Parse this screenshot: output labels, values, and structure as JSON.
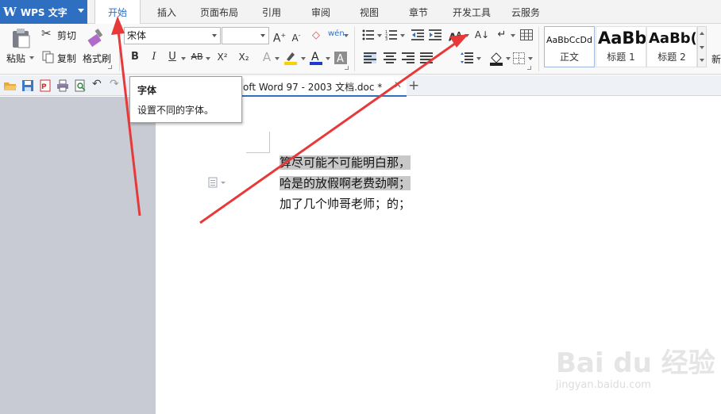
{
  "app": {
    "logo": "W",
    "title": "WPS 文字"
  },
  "tabs": [
    "开始",
    "插入",
    "页面布局",
    "引用",
    "审阅",
    "视图",
    "章节",
    "开发工具",
    "云服务"
  ],
  "clipboard": {
    "paste": "粘贴",
    "cut": "剪切",
    "copy": "复制",
    "format_painter": "格式刷"
  },
  "font": {
    "name": "宋体",
    "size": ""
  },
  "format_buttons": {
    "bold": "B",
    "italic": "I",
    "underline": "U",
    "strike": "AB",
    "superscript": "X²",
    "subscript": "X₂"
  },
  "styles": [
    {
      "sample": "AaBbCcDd",
      "name": "正文"
    },
    {
      "sample": "AaBb",
      "name": "标题 1"
    },
    {
      "sample": "AaBb(",
      "name": "标题 2"
    }
  ],
  "new_style_label": "新",
  "document_tab": {
    "title": "oft Word 97 - 2003 文档.doc *"
  },
  "tooltip": {
    "title": "字体",
    "description": "设置不同的字体。"
  },
  "document": {
    "lines": [
      "算尽可能不可能明白那，",
      "哈是的放假啊老费劲啊；",
      "加了几个帅哥老师；的；"
    ]
  },
  "watermark": {
    "brand": "Bai du 经验",
    "url": "jingyan.baidu.com"
  },
  "colors": {
    "accent": "#2f6fc2",
    "arrow": "#e8393a",
    "font_color": "#1a3ad6",
    "highlight": "#f5d300"
  }
}
